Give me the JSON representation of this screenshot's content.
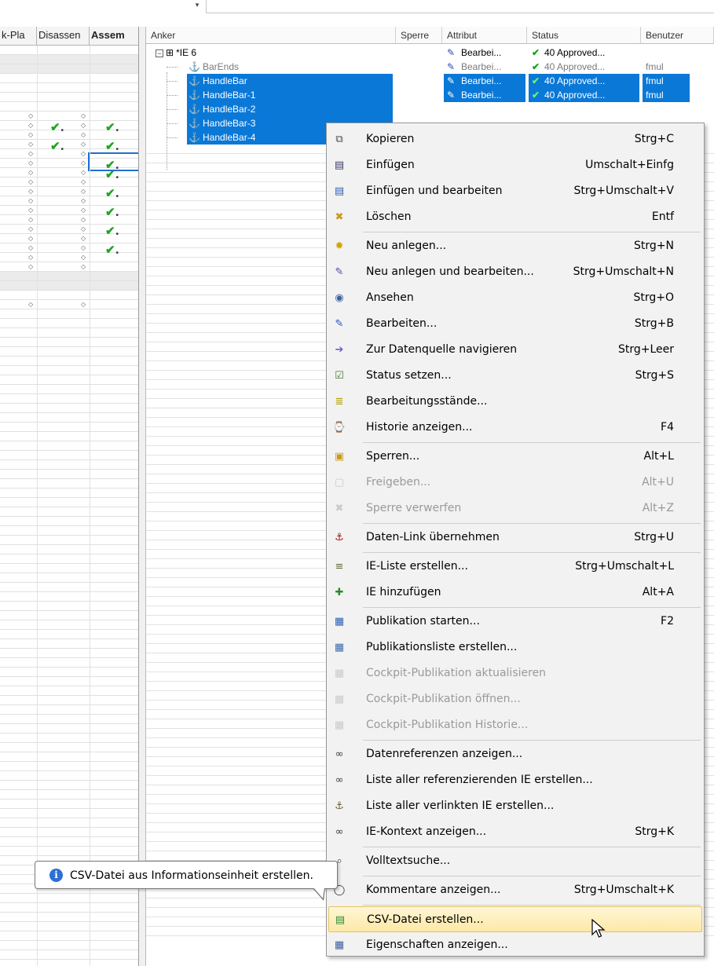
{
  "top": {
    "dropdown_glyph": "▾"
  },
  "left_grid": {
    "columns": [
      "k-Pla",
      "Disassen",
      "Assem"
    ]
  },
  "right_grid": {
    "columns": [
      "Anker",
      "Sperre",
      "Attribut",
      "Status",
      "Benutzer"
    ],
    "rows": [
      {
        "expander": "−",
        "icon": "⊞",
        "name": "*IE 6",
        "attribut": "Bearbei...",
        "status": "40 Approved...",
        "benutzer": ""
      },
      {
        "icon": "⚓",
        "name": "BarEnds",
        "attribut": "Bearbei...",
        "status": "40 Approved...",
        "benutzer": "fmul"
      },
      {
        "icon": "⚓",
        "name": "HandleBar",
        "attribut": "Bearbei...",
        "status": "40 Approved...",
        "benutzer": "fmul"
      },
      {
        "icon": "⚓",
        "name": "HandleBar-1",
        "attribut": "Bearbei...",
        "status": "40 Approved...",
        "benutzer": "fmul"
      },
      {
        "icon": "⚓",
        "name": "HandleBar-2"
      },
      {
        "icon": "⚓",
        "name": "HandleBar-3"
      },
      {
        "icon": "⚓",
        "name": "HandleBar-4"
      }
    ],
    "pencil_glyph": "✎",
    "check_glyph": "✔"
  },
  "context_menu": {
    "items": [
      {
        "label": "Kopieren",
        "shortcut": "Strg+C",
        "icon": "copy-icon",
        "glyph": "⧉",
        "color": "#4a4a4a"
      },
      {
        "label": "Einfügen",
        "shortcut": "Umschalt+Einfg",
        "icon": "paste-icon",
        "glyph": "▤",
        "color": "#3a3a6a"
      },
      {
        "label": "Einfügen und bearbeiten",
        "shortcut": "Strg+Umschalt+V",
        "icon": "paste-edit-icon",
        "glyph": "▤",
        "color": "#2a5fb5"
      },
      {
        "label": "Löschen",
        "shortcut": "Entf",
        "icon": "delete-icon",
        "glyph": "✖",
        "color": "#c89a20"
      },
      {
        "label": "Neu anlegen...",
        "shortcut": "Strg+N",
        "icon": "new-icon",
        "glyph": "✹",
        "color": "#d6a200"
      },
      {
        "label": "Neu anlegen und bearbeiten...",
        "shortcut": "Strg+Umschalt+N",
        "icon": "new-edit-icon",
        "glyph": "✎",
        "color": "#5a3fb0"
      },
      {
        "label": "Ansehen",
        "shortcut": "Strg+O",
        "icon": "view-icon",
        "glyph": "◉",
        "color": "#3a5fa0"
      },
      {
        "label": "Bearbeiten...",
        "shortcut": "Strg+B",
        "icon": "edit-icon",
        "glyph": "✎",
        "color": "#2a4fc0"
      },
      {
        "label": "Zur Datenquelle navigieren",
        "shortcut": "Strg+Leer",
        "icon": "navigate-source-icon",
        "glyph": "➔",
        "color": "#6a5fd0"
      },
      {
        "label": "Status setzen...",
        "shortcut": "Strg+S",
        "icon": "set-status-icon",
        "glyph": "☑",
        "color": "#4a7a2a"
      },
      {
        "label": "Bearbeitungsstände...",
        "shortcut": "",
        "icon": "edit-states-icon",
        "glyph": "≣",
        "color": "#b8a000"
      },
      {
        "label": "Historie anzeigen...",
        "shortcut": "F4",
        "icon": "history-icon",
        "glyph": "⌚",
        "color": "#3a6ab0"
      },
      {
        "label": "Sperren...",
        "shortcut": "Alt+L",
        "icon": "lock-icon",
        "glyph": "▣",
        "color": "#c89a20"
      },
      {
        "label": "Freigeben...",
        "shortcut": "Alt+U",
        "icon": "unlock-icon",
        "glyph": "▢",
        "color": "#9a9a9a",
        "disabled": true
      },
      {
        "label": "Sperre verwerfen",
        "shortcut": "Alt+Z",
        "icon": "discard-lock-icon",
        "glyph": "✖",
        "color": "#9a9a9a",
        "disabled": true
      },
      {
        "label": "Daten-Link übernehmen",
        "shortcut": "Strg+U",
        "icon": "data-link-icon",
        "glyph": "⚓",
        "color": "#a01010"
      },
      {
        "label": "IE-Liste erstellen...",
        "shortcut": "Strg+Umschalt+L",
        "icon": "ie-list-icon",
        "glyph": "≡",
        "color": "#6a6a3a"
      },
      {
        "label": "IE hinzufügen",
        "shortcut": "Alt+A",
        "icon": "ie-add-icon",
        "glyph": "✚",
        "color": "#2a8a2a"
      },
      {
        "label": "Publikation starten...",
        "shortcut": "F2",
        "icon": "publish-start-icon",
        "glyph": "▦",
        "color": "#2a5fb5"
      },
      {
        "label": "Publikationsliste erstellen...",
        "shortcut": "",
        "icon": "publish-list-icon",
        "glyph": "▦",
        "color": "#3a6ab0"
      },
      {
        "label": "Cockpit-Publikation aktualisieren",
        "shortcut": "",
        "icon": "cockpit-refresh-icon",
        "glyph": "▦",
        "color": "#9a9a9a",
        "disabled": true
      },
      {
        "label": "Cockpit-Publikation öffnen...",
        "shortcut": "",
        "icon": "cockpit-open-icon",
        "glyph": "▦",
        "color": "#9a9a9a",
        "disabled": true
      },
      {
        "label": "Cockpit-Publikation Historie...",
        "shortcut": "",
        "icon": "cockpit-history-icon",
        "glyph": "▦",
        "color": "#9a9a9a",
        "disabled": true
      },
      {
        "label": "Datenreferenzen anzeigen...",
        "shortcut": "",
        "icon": "data-references-icon",
        "glyph": "∞",
        "color": "#3a3a3a"
      },
      {
        "label": "Liste aller referenzierenden IE erstellen...",
        "shortcut": "",
        "icon": "referencing-list-icon",
        "glyph": "∞",
        "color": "#3a3a3a"
      },
      {
        "label": "Liste aller verlinkten IE erstellen...",
        "shortcut": "",
        "icon": "linked-list-icon",
        "glyph": "⚓",
        "color": "#6a5a2a"
      },
      {
        "label": "IE-Kontext anzeigen...",
        "shortcut": "Strg+K",
        "icon": "ie-context-icon",
        "glyph": "∞",
        "color": "#3a3a3a"
      },
      {
        "label": "Volltextsuche...",
        "shortcut": "",
        "icon": "fulltext-search-icon",
        "glyph": "⌕",
        "color": "#3a3a3a"
      },
      {
        "label": "Kommentare anzeigen...",
        "shortcut": "Strg+Umschalt+K",
        "icon": "comments-icon",
        "glyph": "◯",
        "color": "#3a3a3a"
      },
      {
        "label": "CSV-Datei erstellen...",
        "shortcut": "",
        "icon": "csv-file-icon",
        "glyph": "▤",
        "color": "#2a8a3a",
        "highlighted": true
      },
      {
        "label": "Eigenschaften anzeigen...",
        "shortcut": "",
        "icon": "properties-icon",
        "glyph": "▦",
        "color": "#3a5fa0"
      }
    ]
  },
  "tooltip": {
    "icon_glyph": "i",
    "text": "CSV-Datei aus Informationseinheit erstellen."
  }
}
